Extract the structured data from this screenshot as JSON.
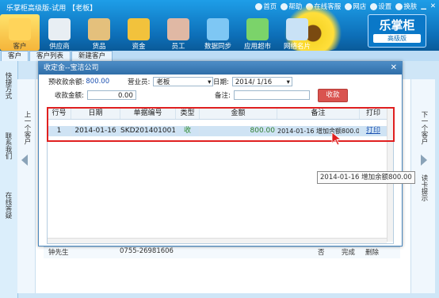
{
  "app": {
    "title": "乐掌柜高级版-试用 【老板】"
  },
  "top_links": [
    "首页",
    "帮助",
    "在线客服",
    "网店",
    "设置",
    "换肤"
  ],
  "toolbar": [
    {
      "label": "客户",
      "active": true,
      "color": "#ffd45a"
    },
    {
      "label": "供应商",
      "active": false,
      "color": "#e8eef3"
    },
    {
      "label": "货品",
      "active": false,
      "color": "#e4c07c"
    },
    {
      "label": "资金",
      "active": false,
      "color": "#f2c23c"
    },
    {
      "label": "员工",
      "active": false,
      "color": "#e0b8a4"
    },
    {
      "label": "数据同步",
      "active": false,
      "color": "#7ec7f4"
    },
    {
      "label": "应用超市",
      "active": false,
      "color": "#7bd36a"
    },
    {
      "label": "网络名片",
      "active": false,
      "color": "#c9e2f6"
    }
  ],
  "brand": {
    "name": "乐掌柜",
    "edition": "高级版"
  },
  "tabs": [
    "客户",
    "客户列表",
    "新建客户"
  ],
  "side": {
    "quick": "快捷方式",
    "contact": "联系我们",
    "online": "在线答疑",
    "prev": "上一个客户",
    "next": "下一个客户",
    "read_tips": "读卡提示"
  },
  "dialog": {
    "title": "收定金--宝洁公司",
    "prepay_label": "预收款余额:",
    "prepay_value": "800.00",
    "sales_label": "营业员:",
    "sales_value": "老板",
    "date_label": "日期:",
    "date_value": "2014/ 1/16",
    "collect_label": "收款金额:",
    "collect_value": "0.00",
    "remark_label": "备注:",
    "remark_value": "",
    "save_label": "收款"
  },
  "grid": {
    "headers": [
      "行号",
      "日期",
      "单据编号",
      "类型",
      "金额",
      "备注",
      "打印"
    ],
    "rows": [
      {
        "no": "1",
        "date": "2014-01-16",
        "doc": "SKD2014010011",
        "type": "收",
        "amount": "800.00",
        "remark": "2014-01-16 增加余额800.00",
        "print": "打印"
      }
    ]
  },
  "tooltip": "2014-01-16 增加余额800.00",
  "background_row": {
    "name": "钟先生",
    "phone": "0755-26981606",
    "a": "否",
    "b": "完成",
    "c": "删除"
  },
  "colors": {
    "accent": "#0d6fb8",
    "highlight": "#e02020",
    "save": "#d9534f",
    "selected_row": "#cfe3f4"
  }
}
